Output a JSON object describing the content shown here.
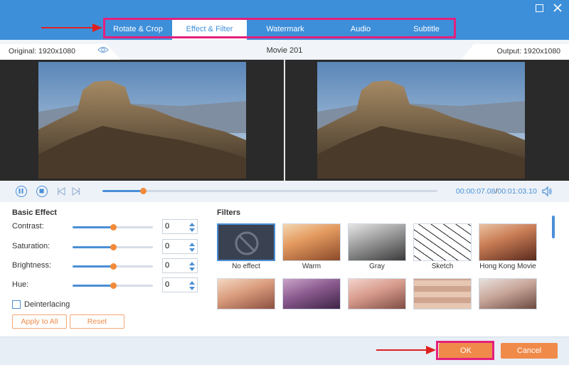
{
  "window": {
    "maximize_icon": "maximize-icon",
    "close_icon": "close-icon"
  },
  "tabs": [
    {
      "label": "Rotate & Crop",
      "active": false
    },
    {
      "label": "Effect & Filter",
      "active": true
    },
    {
      "label": "Watermark",
      "active": false
    },
    {
      "label": "Audio",
      "active": false
    },
    {
      "label": "Subtitle",
      "active": false
    }
  ],
  "info": {
    "original": "Original: 1920x1080",
    "title": "Movie 201",
    "output": "Output: 1920x1080"
  },
  "playback": {
    "current_time": "00:00:07.08",
    "separator": "/",
    "total_time": "00:01:03.10",
    "progress": 0.12
  },
  "basic_effect": {
    "title": "Basic Effect",
    "rows": [
      {
        "label": "Contrast:",
        "value": "0",
        "level": 0.5
      },
      {
        "label": "Saturation:",
        "value": "0",
        "level": 0.5
      },
      {
        "label": "Brightness:",
        "value": "0",
        "level": 0.5
      },
      {
        "label": "Hue:",
        "value": "0",
        "level": 0.5
      }
    ],
    "deinterlacing": "Deinterlacing",
    "apply_all": "Apply to All",
    "reset": "Reset"
  },
  "filters": {
    "title": "Filters",
    "items": [
      {
        "label": "No effect",
        "style": "none",
        "selected": true
      },
      {
        "label": "Warm",
        "style": "warm",
        "selected": false
      },
      {
        "label": "Gray",
        "style": "gray",
        "selected": false
      },
      {
        "label": "Sketch",
        "style": "sketch",
        "selected": false
      },
      {
        "label": "Hong Kong Movie",
        "style": "hk",
        "selected": false
      }
    ],
    "row2": [
      "peach",
      "purple",
      "rose",
      "mosaic",
      "cool"
    ]
  },
  "footer": {
    "ok": "OK",
    "cancel": "Cancel"
  },
  "colors": {
    "accent": "#3e8fda",
    "orange": "#f08a4a",
    "highlight": "#e4207c"
  }
}
